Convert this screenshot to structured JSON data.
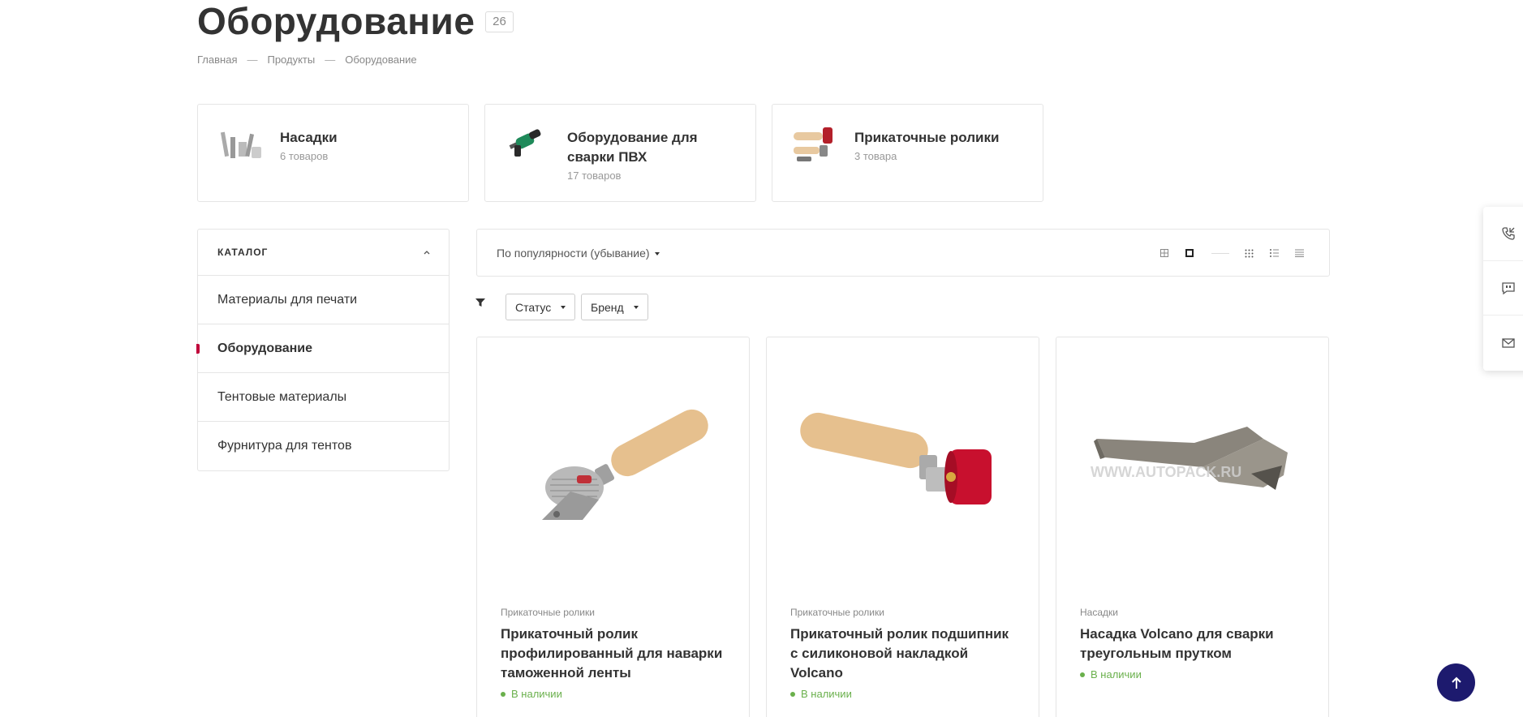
{
  "page": {
    "title": "Оборудование",
    "count": "26"
  },
  "breadcrumb": {
    "home": "Главная",
    "products": "Продукты",
    "current": "Оборудование",
    "sep": "—"
  },
  "categories": [
    {
      "name": "Насадки",
      "sub": "6 товаров",
      "icon": "nozzle-set"
    },
    {
      "name": "Оборудование для сварки ПВХ",
      "sub": "17 товаров",
      "icon": "heat-gun"
    },
    {
      "name": "Прикаточные ролики",
      "sub": "3 товара",
      "icon": "roller"
    }
  ],
  "sidebar": {
    "title": "КАТАЛОГ",
    "items": [
      {
        "label": "Материалы для печати"
      },
      {
        "label": "Оборудование"
      },
      {
        "label": "Тентовые материалы"
      },
      {
        "label": "Фурнитура для тентов"
      }
    ]
  },
  "sort": {
    "label": "По популярности (убывание)"
  },
  "filters": {
    "status": "Статус",
    "brand": "Бренд"
  },
  "products": [
    {
      "category": "Прикаточные ролики",
      "name": "Прикаточный ролик профилированный для наварки таможенной ленты",
      "stock": "В наличии"
    },
    {
      "category": "Прикаточные ролики",
      "name": "Прикаточный ролик подшипник с силиконовой накладкой Volcano",
      "stock": "В наличии"
    },
    {
      "category": "Насадки",
      "name": "Насадка Volcano для сварки треугольным прутком",
      "stock": "В наличии",
      "watermark": "WWW.AUTOPACK.RU"
    }
  ],
  "colors": {
    "accent": "#c0003a",
    "stock": "#6ab04c",
    "toTop": "#1d1a6e"
  }
}
